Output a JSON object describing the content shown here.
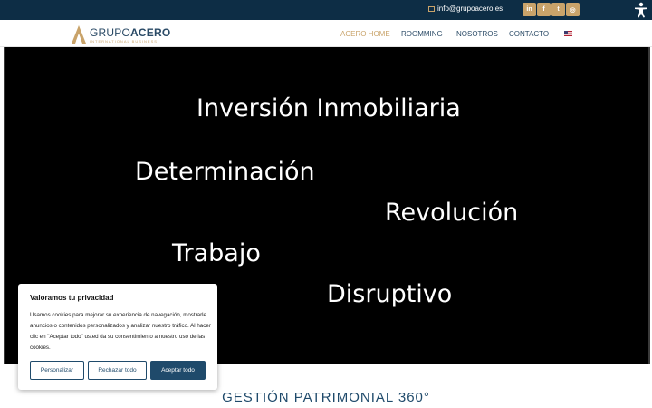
{
  "topbar": {
    "email": "info@grupoacero.es",
    "social": [
      {
        "icon": "linkedin-icon",
        "glyph": "in"
      },
      {
        "icon": "facebook-icon",
        "glyph": "f"
      },
      {
        "icon": "twitter-icon",
        "glyph": "t"
      },
      {
        "icon": "instagram-icon",
        "glyph": "◎"
      }
    ]
  },
  "logo": {
    "brand_light": "GRUPO",
    "brand_bold": "ACERO",
    "tagline": "INTERNATIONAL BUSINESS"
  },
  "nav": {
    "items": [
      {
        "label": "ACERO HOME",
        "active": true
      },
      {
        "label": "ROOMMING",
        "active": false
      },
      {
        "label": "NOSOTROS",
        "active": false
      },
      {
        "label": "CONTACTO",
        "active": false
      }
    ],
    "language_icon": "us-flag-icon"
  },
  "hero": {
    "words": [
      "Inversión Inmobiliaria",
      "Determinación",
      "Revolución",
      "Trabajo",
      "Disruptivo"
    ]
  },
  "section": {
    "title": "GESTIÓN PATRIMONIAL 360°"
  },
  "cookie": {
    "title": "Valoramos tu privacidad",
    "body": "Usamos cookies para mejorar su experiencia de navegación, mostrarle anuncios o contenidos personalizados y analizar nuestro tráfico. Al hacer clic en \"Aceptar todo\" usted da su consentimiento a nuestro uso de las cookies.",
    "buttons": {
      "customize": "Personalizar",
      "reject": "Rechazar todo",
      "accept": "Aceptar todo"
    }
  },
  "colors": {
    "navy": "#0d2d45",
    "gold": "#c9a36a",
    "button_blue": "#1f4a6b"
  }
}
